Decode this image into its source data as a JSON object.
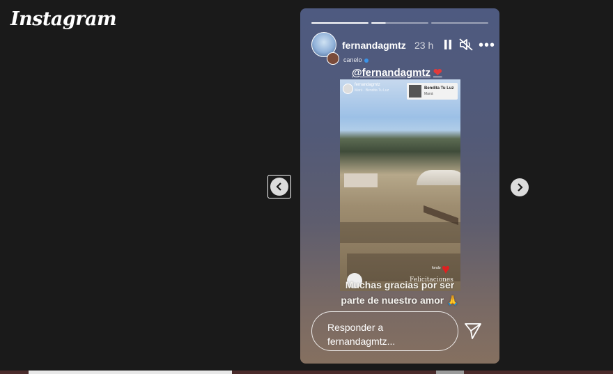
{
  "brand": {
    "logo_text": "Instagram"
  },
  "story": {
    "username": "fernandagmtz",
    "time_ago": "23 h",
    "reposted_from": "canelo",
    "mention_text": "@fernandagmtz",
    "mention_emoji": "❤",
    "caption_line1": "Muchas gracias por ser",
    "caption_line2": "parte de nuestro amor 🙏",
    "photo": {
      "mini_username": "fernandagmtz",
      "mini_subtitle": "Marú · Bendita Tu Luz",
      "music_song": "Bendita Tu Luz",
      "music_artist": "Maná",
      "overlay_text": "Felicitaciones",
      "small_tag": "fondo"
    },
    "reply_placeholder_line1": "Responder a",
    "reply_placeholder_line2": "fernandagmtz...",
    "progress": {
      "segments": 3,
      "completed": 1,
      "current_fraction": 0.25
    }
  },
  "icons": {
    "prev": "chevron-left-icon",
    "next": "chevron-right-icon",
    "pause": "pause-icon",
    "mute": "muted-speaker-icon",
    "more": "more-options-icon",
    "send": "send-icon"
  },
  "colors": {
    "background": "#1a1a1a",
    "heart": "#e23a3a",
    "verified": "#3a93e8"
  }
}
